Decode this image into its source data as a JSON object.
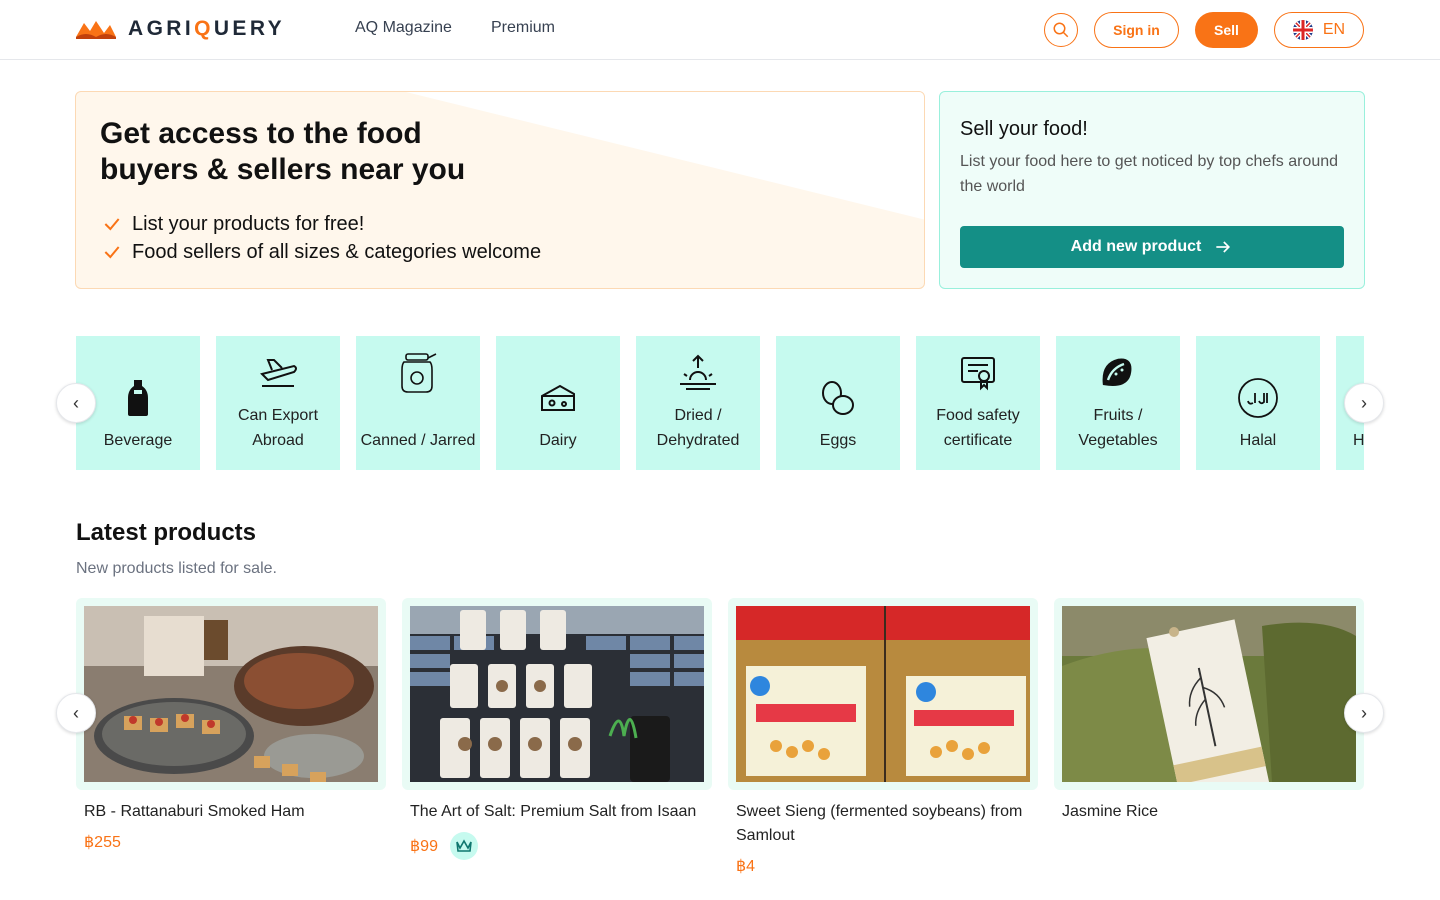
{
  "header": {
    "brand": {
      "prefix": "AGRI",
      "q": "Q",
      "suffix": "UERY"
    },
    "nav": [
      "AQ Magazine",
      "Premium"
    ],
    "sign_in": "Sign in",
    "sell": "Sell",
    "language": "EN"
  },
  "hero": {
    "title": "Get access to the food buyers & sellers near you",
    "points": [
      "List your products for free!",
      "Food sellers of all sizes & categories welcome"
    ]
  },
  "sell_card": {
    "title": "Sell your food!",
    "description": "List your food here to get noticed by top chefs around the world",
    "button": "Add new product"
  },
  "categories": [
    {
      "label": "Beverage",
      "icon": "bottle-icon"
    },
    {
      "label": "Can Export Abroad",
      "icon": "plane-icon"
    },
    {
      "label": "Canned / Jarred",
      "icon": "jar-icon"
    },
    {
      "label": "Dairy",
      "icon": "cheese-icon"
    },
    {
      "label": "Dried / Dehydrated",
      "icon": "sun-icon"
    },
    {
      "label": "Eggs",
      "icon": "eggs-icon"
    },
    {
      "label": "Food safety certificate",
      "icon": "certificate-icon"
    },
    {
      "label": "Fruits / Vegetables",
      "icon": "fruit-icon"
    },
    {
      "label": "Halal",
      "icon": "halal-icon"
    },
    {
      "label": "H",
      "icon": ""
    }
  ],
  "latest": {
    "title": "Latest products",
    "subtitle": "New products listed for sale.",
    "products": [
      {
        "name": "RB - Rattanaburi Smoked Ham",
        "price": "฿255",
        "premium": false
      },
      {
        "name": "The Art of Salt: Premium Salt from Isaan",
        "price": "฿99",
        "premium": true
      },
      {
        "name": "Sweet Sieng (fermented soybeans) from Samlout",
        "price": "฿4",
        "premium": false
      },
      {
        "name": "Jasmine Rice",
        "price": "",
        "premium": false
      }
    ]
  },
  "colors": {
    "accent": "#f97316",
    "teal": "#148f86",
    "mint": "#c6faef"
  }
}
